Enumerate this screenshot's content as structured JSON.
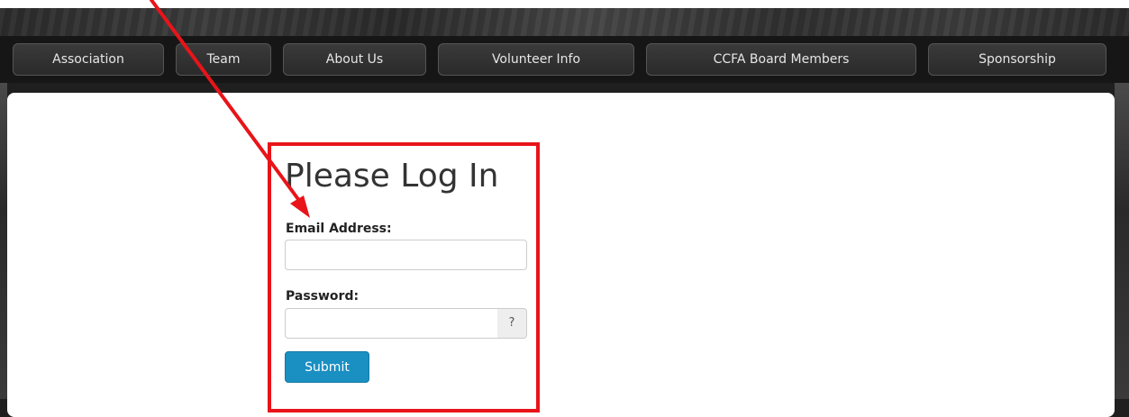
{
  "nav": {
    "tabs": [
      {
        "label": "Association"
      },
      {
        "label": "Team"
      },
      {
        "label": "About Us"
      },
      {
        "label": "Volunteer Info"
      },
      {
        "label": "CCFA Board Members"
      },
      {
        "label": "Sponsorship"
      }
    ]
  },
  "login": {
    "title": "Please Log In",
    "email_label": "Email Address:",
    "email_value": "",
    "password_label": "Password:",
    "password_value": "",
    "help_button_label": "?",
    "submit_label": "Submit"
  },
  "colors": {
    "highlight_box": "#e8141a",
    "submit_button": "#1a8fc2",
    "nav_tab": "#333333"
  }
}
